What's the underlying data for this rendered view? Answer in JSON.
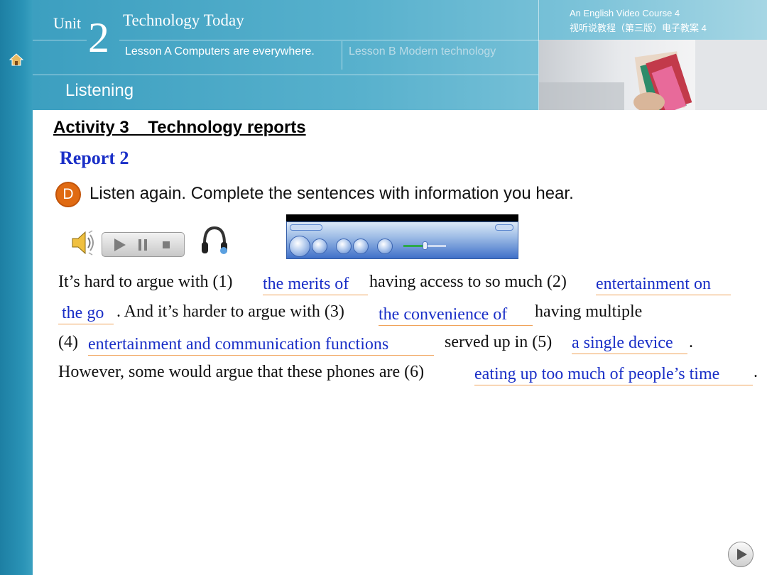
{
  "header": {
    "unit_word": "Unit",
    "unit_number": "2",
    "unit_title": "Technology Today",
    "lesson_a": "Lesson A Computers are everywhere.",
    "lesson_b": "Lesson B Modern technology",
    "course_en": "An English Video Course 4",
    "course_cn": "视听说教程（第三版）电子教案 4",
    "section": "Listening"
  },
  "activity": {
    "title": "Activity 3    Technology reports",
    "report": "Report 2",
    "badge": "D",
    "instruction": "Listen again. Complete the sentences with information you hear."
  },
  "paragraph": {
    "l1a": "It’s hard to argue with (1)",
    "a1": "the merits of ",
    "l1b": "having access to so much (2)",
    "a2": "entertainment on ",
    "a2b": "the go ",
    "l2a": ". And it’s harder to argue with (3)",
    "a3": "the convenience of ",
    "l2b": "having multiple",
    "l3a": "(4)",
    "a4": "entertainment and communication functions ",
    "l3b": "served up in (5)",
    "a5": "a single device ",
    "l3c": ".",
    "l4a": "However, some would argue that these phones are (6)",
    "a6": "eating up too much of people’s time",
    "l4b": "."
  },
  "colors": {
    "accent": "#1a2fc7",
    "badge": "#e06a12",
    "header_teal": "#3c9fc0",
    "answer_underline": "#f0a35a"
  },
  "icons": [
    "home-icon",
    "speaker-icon",
    "play-icon",
    "pause-icon",
    "stop-icon",
    "headphones-icon",
    "next-slide-icon"
  ]
}
